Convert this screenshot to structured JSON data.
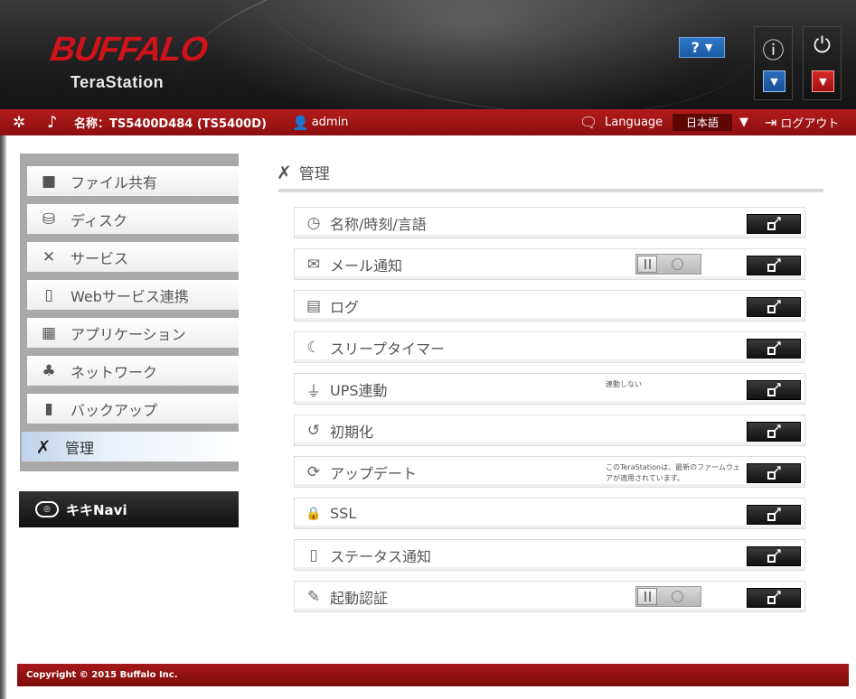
{
  "header": {
    "brand": "BUFFALO",
    "product": "TeraStation",
    "help_label": "?",
    "info_glyph": "ⓘ",
    "power_glyph": "⏻"
  },
  "topbar": {
    "device_name": "名称：TS5400D484 (TS5400D)",
    "user": "admin",
    "language_label": "Language",
    "language_value": "日本語",
    "logout_label": "ログアウト"
  },
  "sidebar": {
    "items": [
      {
        "label": "ファイル共有",
        "icon": "folder-icon",
        "glyph": "■"
      },
      {
        "label": "ディスク",
        "icon": "disk-icon",
        "glyph": "⛁"
      },
      {
        "label": "サービス",
        "icon": "service-icon",
        "glyph": "✕"
      },
      {
        "label": "Webサービス連携",
        "icon": "web-service-icon",
        "glyph": "▯"
      },
      {
        "label": "アプリケーション",
        "icon": "application-icon",
        "glyph": "▦"
      },
      {
        "label": "ネットワーク",
        "icon": "network-icon",
        "glyph": "♣"
      },
      {
        "label": "バックアップ",
        "icon": "backup-icon",
        "glyph": "▮"
      },
      {
        "label": "管理",
        "icon": "tools-icon",
        "glyph": "✗",
        "active": true
      }
    ],
    "navi_label": "キキNavi"
  },
  "main": {
    "title": "管理",
    "rows": [
      {
        "label": "名称/時刻/言語",
        "icon": "clock-icon",
        "glyph": "◷",
        "status": ""
      },
      {
        "label": "メール通知",
        "icon": "mail-icon",
        "glyph": "✉",
        "toggle": true,
        "status": ""
      },
      {
        "label": "ログ",
        "icon": "log-icon",
        "glyph": "▤",
        "status": ""
      },
      {
        "label": "スリープタイマー",
        "icon": "sleep-icon",
        "glyph": "☾",
        "status": ""
      },
      {
        "label": "UPS連動",
        "icon": "plug-icon",
        "glyph": "⏚",
        "status": "連動しない"
      },
      {
        "label": "初期化",
        "icon": "reset-icon",
        "glyph": "↺",
        "status": ""
      },
      {
        "label": "アップデート",
        "icon": "update-icon",
        "glyph": "⟳",
        "status": "このTeraStationは、最新のファームウェアが適用されています。"
      },
      {
        "label": "SSL",
        "icon": "lock-icon",
        "glyph": "🔒",
        "status": ""
      },
      {
        "label": "ステータス通知",
        "icon": "status-notify-icon",
        "glyph": "▯",
        "status": ""
      },
      {
        "label": "起動認証",
        "icon": "boot-auth-icon",
        "glyph": "✎",
        "toggle": true,
        "status": ""
      }
    ]
  },
  "footer": {
    "copyright": "Copyright © 2015 Buffalo Inc."
  }
}
